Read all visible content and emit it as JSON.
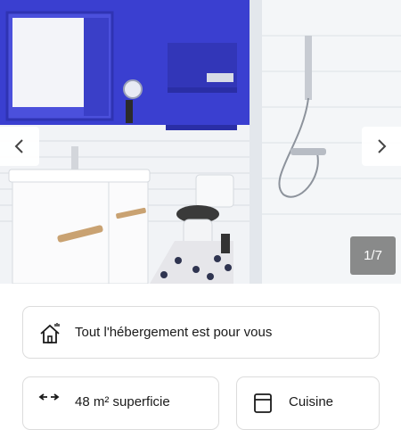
{
  "gallery": {
    "counter": "1/7",
    "prev_icon": "chevron-left-icon",
    "next_icon": "chevron-right-icon",
    "accent_wall_color": "#3a3fd0"
  },
  "accommodation": {
    "main_label": "Tout l'hébergement est pour vous",
    "main_icon": "home-icon"
  },
  "features": [
    {
      "label": "48 m² superficie",
      "icon": "area-arrows-icon"
    },
    {
      "label": "Cuisine",
      "icon": "kitchen-icon"
    }
  ]
}
